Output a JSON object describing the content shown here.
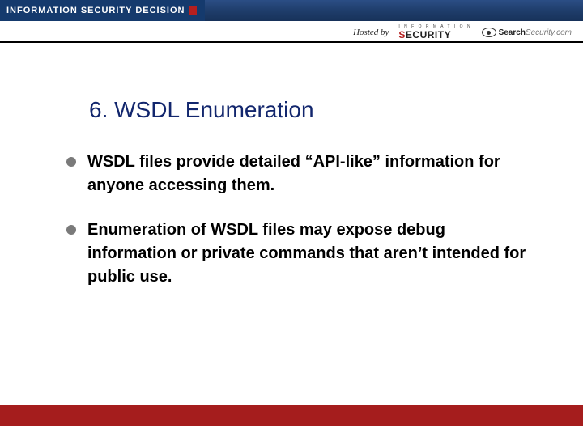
{
  "banner": {
    "badge_text": "INFORMATION SECURITY DECISION",
    "hosted_by": "Hosted by",
    "security_small": "I N F O R M A T I O N",
    "security_big_red": "S",
    "security_big_rest": "ECURITY",
    "search_name": "Search",
    "search_suffix": "Security.com"
  },
  "slide": {
    "title": "6. WSDL Enumeration",
    "bullets": [
      "WSDL files provide detailed “API-like” information for anyone accessing them.",
      "Enumeration of WSDL files may expose debug information or private commands that aren’t intended for public use."
    ]
  }
}
